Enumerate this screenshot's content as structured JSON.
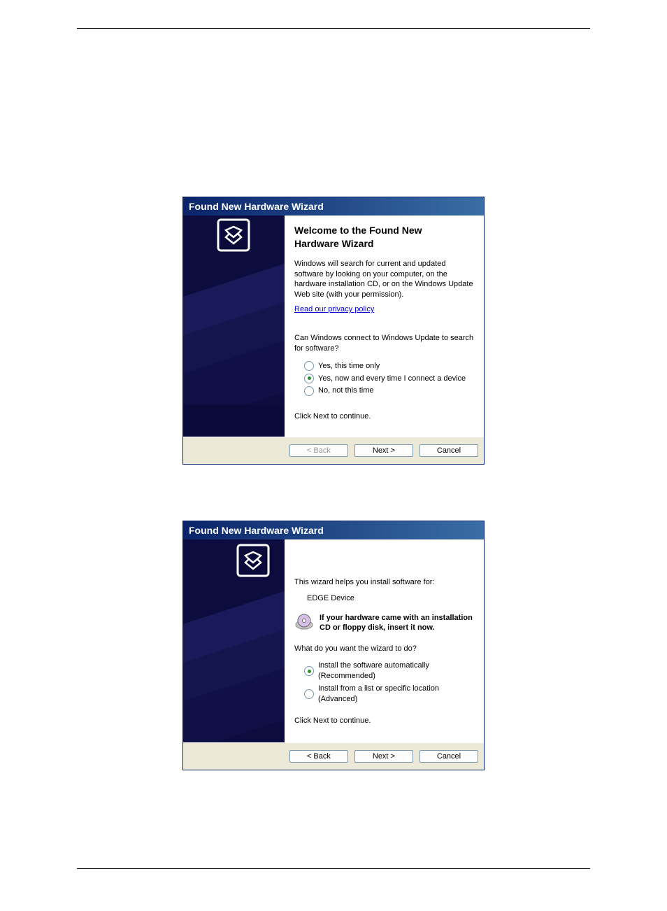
{
  "dialog1": {
    "title": "Found New Hardware Wizard",
    "heading_line1": "Welcome to the Found New",
    "heading_line2": "Hardware Wizard",
    "intro": "Windows will search for current and updated software by looking on your computer, on the hardware installation CD, or on the Windows Update Web site (with your permission).",
    "privacy_link": "Read our privacy policy",
    "question": "Can Windows connect to Windows Update to search for software?",
    "options": [
      {
        "label": "Yes, this time only",
        "selected": false
      },
      {
        "label": "Yes, now and every time I connect a device",
        "selected": true
      },
      {
        "label": "No, not this time",
        "selected": false
      }
    ],
    "continue": "Click Next to continue.",
    "back": "< Back",
    "next": "Next >",
    "cancel": "Cancel"
  },
  "dialog2": {
    "title": "Found New Hardware Wizard",
    "intro": "This wizard helps you install software for:",
    "device": "EDGE Device",
    "cd_hint": "If your hardware came with an installation CD or floppy disk, insert it now.",
    "question": "What do you want the wizard to do?",
    "options": [
      {
        "label": "Install the software automatically (Recommended)",
        "selected": true
      },
      {
        "label": "Install from a list or specific location (Advanced)",
        "selected": false
      }
    ],
    "continue": "Click Next to continue.",
    "back": "< Back",
    "next": "Next >",
    "cancel": "Cancel"
  }
}
